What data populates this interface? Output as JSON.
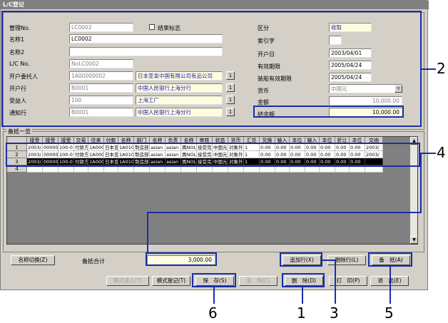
{
  "window": {
    "title": "L/C登记"
  },
  "form": {
    "kanri_label": "管理No.",
    "kanri_value": "LC0002",
    "kesshu_label": "结束标志",
    "name1_label": "名称1",
    "name1_value": "LC0002",
    "name2_label": "名称2",
    "name2_value": "",
    "lcno_label": "L/C No.",
    "lcno_value": "NoLC0002",
    "irai_label": "开户委托人",
    "irai_code": "1A00000002",
    "irai_name": "日本亚发中国有限公司有品公司",
    "bank_label": "开户行",
    "bank_code": "B0001",
    "bank_name": "中国人民银行上海分行",
    "juekiin_label": "受益人",
    "juekiin_code": "100",
    "juekiin_name": "上海工厂",
    "tsuchi_label": "通知行",
    "tsuchi_code": "B0001",
    "tsuchi_name": "中国人民银行上海分行",
    "kubun_label": "区分",
    "kubun_value": "收取",
    "index_label": "索引字",
    "index_value": "",
    "kaisetsu_label": "开户日",
    "kaisetsu_value": "2003/04/01",
    "yuko_label": "有效期限",
    "yuko_value": "2005/04/24",
    "funazumi_label": "装船有效期限",
    "funazumi_value": "2005/04/24",
    "currency_label": "货币",
    "currency_value": "中国元",
    "amount_label": "金额",
    "amount_value": "10,000.00",
    "zandaka_label": "结余额",
    "zandaka_value": "10,000.00",
    "ref_btn": "1"
  },
  "list": {
    "group_label": "备抵一览",
    "headers": [
      "接受",
      "接受",
      "接受",
      "交易",
      "往来",
      "付款",
      "名称",
      "部门",
      "名称",
      "负责",
      "名称",
      "审核",
      "状态",
      "货币",
      "汇兑",
      "兑换",
      "输入",
      "本位",
      "输入",
      "本位",
      "折让",
      "本位",
      "交纳"
    ],
    "rows": [
      {
        "num": "1",
        "cells": [
          "2003/",
          "00000",
          "100-0",
          "付款方",
          "1A000",
          "日本亚",
          "1A010",
          "制造部",
          "asian",
          "asian",
          "再NOL",
          "接受完",
          "中国元",
          "对象外",
          "1",
          "0.00",
          "0.00",
          "0.00",
          "0.00",
          "0.00",
          "0.00",
          "0.00",
          "2003/"
        ]
      },
      {
        "num": "2",
        "cells": [
          "2003/",
          "00000",
          "100-0",
          "付款方",
          "1A000",
          "日本亚",
          "1A010",
          "制造部",
          "asian",
          "asian",
          "再NOL",
          "接受完",
          "中国元",
          "对象外",
          "1",
          "0.00",
          "0.00",
          "0.00",
          "0.00",
          "0.00",
          "0.00",
          "0.00",
          "2003/"
        ]
      },
      {
        "num": "3",
        "cells": [
          "2003/",
          "00000",
          "100-0",
          "付款方",
          "1A000",
          "日本亚",
          "1A010",
          "制造部",
          "asian",
          "asian",
          "再NOL",
          "接受完",
          "中国元",
          "对象外",
          "1",
          "0.00",
          "0.00",
          "0.00",
          "0.00",
          "0.00",
          "0.00",
          "0.00",
          ""
        ]
      },
      {
        "num": "4",
        "cells": [
          "",
          "",
          "",
          "",
          "",
          "",
          "",
          "",
          "",
          "",
          "",
          "",
          "",
          "",
          "",
          "",
          "",
          "",
          "",
          "",
          "",
          "",
          ""
        ]
      }
    ]
  },
  "bottom": {
    "name_switch": "名称切换(Z)",
    "total_label": "备抵合计",
    "total_value": "3,000.00",
    "add_row": "追加行(X)",
    "del_row": "删除行(L)",
    "bikou": "备　抵(A)",
    "mode_import": "模式读入(Y)",
    "mode_reg": "模式登记(T)",
    "save": "保　存(S)",
    "clear": "清　除(C)",
    "delete": "删　除(D)",
    "print": "打　印(P)",
    "exit": "退　出(E)"
  },
  "callouts": {
    "c1": "1",
    "c2": "2",
    "c3": "3",
    "c4": "4",
    "c5": "5",
    "c6": "6"
  }
}
